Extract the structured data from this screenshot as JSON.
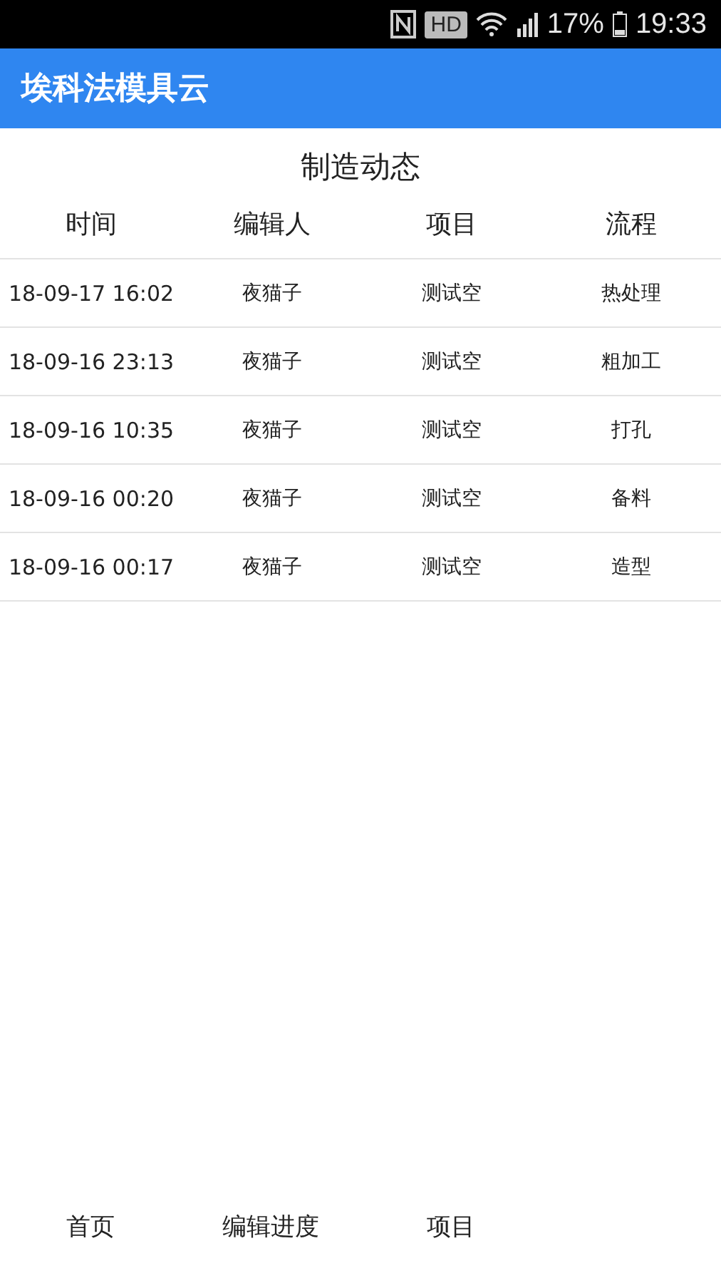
{
  "status_bar": {
    "battery": "17%",
    "time": "19:33",
    "hd": "HD"
  },
  "app_bar": {
    "title": "埃科法模具云"
  },
  "section": {
    "title": "制造动态"
  },
  "table": {
    "columns": [
      "时间",
      "编辑人",
      "项目",
      "流程"
    ],
    "rows": [
      [
        "18-09-17 16:02",
        "夜猫子",
        "测试空",
        "热处理"
      ],
      [
        "18-09-16 23:13",
        "夜猫子",
        "测试空",
        "粗加工"
      ],
      [
        "18-09-16 10:35",
        "夜猫子",
        "测试空",
        "打孔"
      ],
      [
        "18-09-16 00:20",
        "夜猫子",
        "测试空",
        "备料"
      ],
      [
        "18-09-16 00:17",
        "夜猫子",
        "测试空",
        "造型"
      ]
    ]
  },
  "bottom_nav": [
    "首页",
    "编辑进度",
    "项目"
  ]
}
